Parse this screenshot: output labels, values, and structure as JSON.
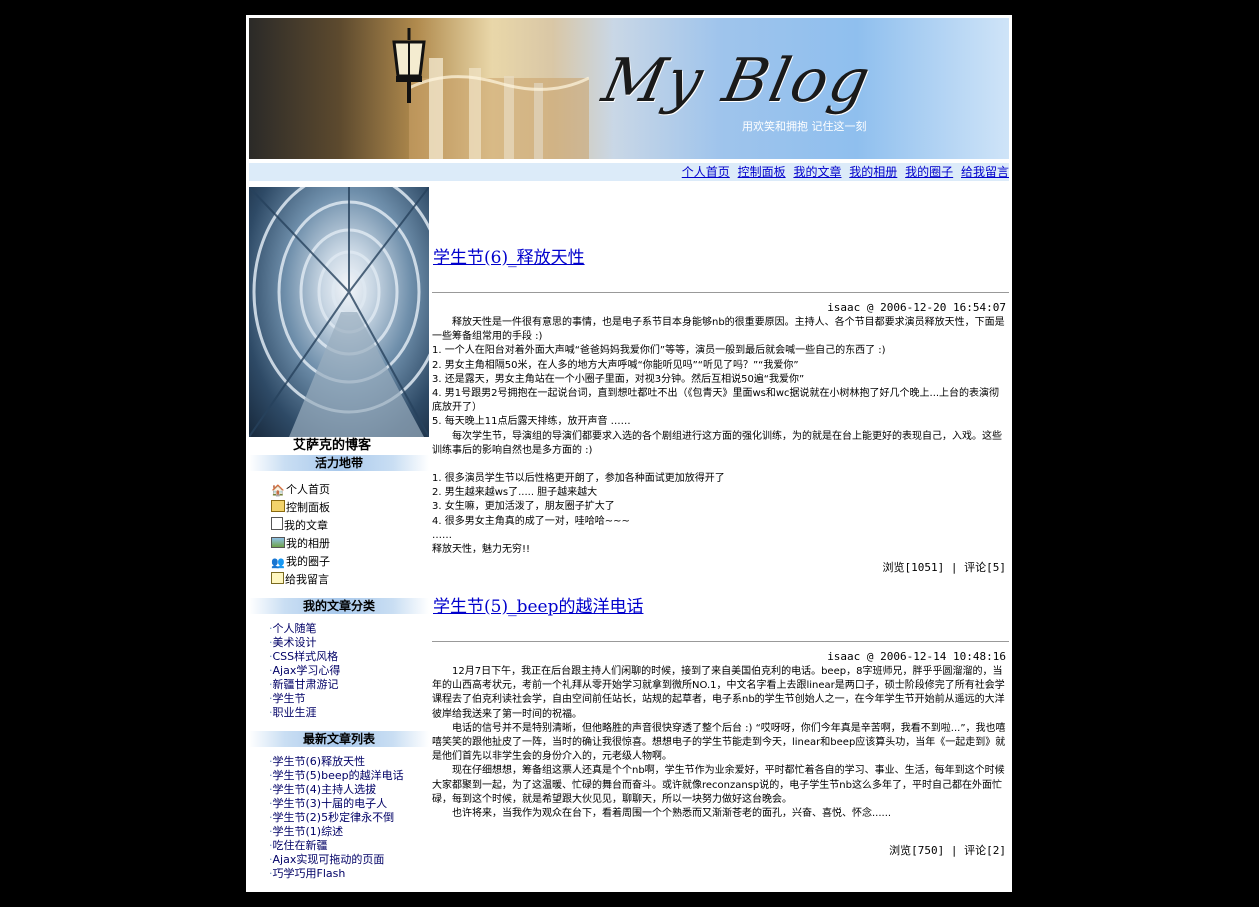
{
  "banner": {
    "logo": "My Blog",
    "motto": "用欢笑和拥抱 记住这一刻"
  },
  "nav": [
    "个人首页",
    "控制面板",
    "我的文章",
    "我的相册",
    "我的圈子",
    "给我留言"
  ],
  "sidebar": {
    "owner": "艾萨克的博客",
    "section_vitality": "活力地带",
    "menu": [
      {
        "label": "个人首页",
        "icon": "home-icon"
      },
      {
        "label": "控制面板",
        "icon": "panel-icon"
      },
      {
        "label": "我的文章",
        "icon": "article-icon"
      },
      {
        "label": "我的相册",
        "icon": "photo-icon"
      },
      {
        "label": "我的圈子",
        "icon": "group-icon"
      },
      {
        "label": "给我留言",
        "icon": "message-icon"
      }
    ],
    "section_categories": "我的文章分类",
    "categories": [
      "个人随笔",
      "美术设计",
      "CSS样式风格",
      "Ajax学习心得",
      "新疆甘肃游记",
      "学生节",
      "职业生涯"
    ],
    "section_latest": "最新文章列表",
    "latest": [
      "学生节(6)释放天性",
      "学生节(5)beep的越洋电话",
      "学生节(4)主持人选拔",
      "学生节(3)十届的电子人",
      "学生节(2)5秒定律永不倒",
      "学生节(1)综述",
      "吃住在新疆",
      "Ajax实现可拖动的页面",
      "巧学巧用Flash"
    ]
  },
  "posts": [
    {
      "title": "学生节(6)_释放天性",
      "meta": "isaac @ 2006-12-20 16:54:07",
      "paragraphs": [
        "　　释放天性是一件很有意思的事情，也是电子系节目本身能够nb的很重要原因。主持人、各个节目都要求演员释放天性，下面是一些筹备组常用的手段 :)",
        "1. 一个人在阳台对着外面大声喊“爸爸妈妈我爱你们”等等，演员一般到最后就会喊一些自己的东西了 :)",
        "2. 男女主角相隔50米，在人多的地方大声呼喊“你能听见吗”“听见了吗？”“我爱你”",
        "3. 还是露天，男女主角站在一个小圈子里面，对视3分钟。然后互相说50遍“我爱你”",
        "4. 男1号跟男2号拥抱在一起说台词，直到想吐都吐不出（《包青天》里面ws和wc据说就在小树林抱了好几个晚上...上台的表演彻底放开了）",
        "5. 每天晚上11点后露天排练，放开声音 ……",
        "　　每次学生节，导演组的导演们都要求入选的各个剧组进行这方面的强化训练，为的就是在台上能更好的表现自己，入戏。这些训练事后的影响自然也是多方面的 :)",
        "",
        "1. 很多演员学生节以后性格更开朗了，参加各种面试更加放得开了",
        "2. 男生越来越ws了.....  胆子越来越大",
        "3. 女生嘛，更加活泼了，朋友圈子扩大了",
        "4. 很多男女主角真的成了一对，哇哈哈~~~",
        "……",
        "释放天性，魅力无穷!!"
      ],
      "stats": "浏览[1051] | 评论[5]"
    },
    {
      "title": "学生节(5)_beep的越洋电话",
      "meta": "isaac @ 2006-12-14 10:48:16",
      "paragraphs": [
        "　　12月7日下午，我正在后台跟主持人们闲聊的时候，接到了来自美国伯克利的电话。beep，8字班师兄，胖乎乎圆溜溜的，当年的山西高考状元，考前一个礼拜从零开始学习就拿到微所NO.1，中文名字看上去跟linear是两口子，硕士阶段修完了所有社会学课程去了伯克利读社会学，自由空间前任站长，站规的起草者，电子系nb的学生节创始人之一，在今年学生节开始前从遥远的大洋彼岸给我送来了第一时间的祝福。",
        "　　电话的信号并不是特别清晰，但他略胜的声音很快穿透了整个后台 :) “哎呀呀，你们今年真是辛苦啊，我看不到啦...”，我也嘻嘻笑笑的跟他扯皮了一阵，当时的确让我很惊喜。想想电子的学生节能走到今天，linear和beep应该算头功，当年《一起走到》就是他们首先以非学生会的身份介入的，元老级人物啊。",
        "　　现在仔细想想，筹备组这票人还真是个个nb啊，学生节作为业余爱好，平时都忙着各自的学习、事业、生活，每年到这个时候大家都聚到一起，为了这温暖、忙碌的舞台而奋斗。或许就像reconzansp说的，电子学生节nb这么多年了，平时自己都在外面忙碌，每到这个时候，就是希望跟大伙见见，聊聊天，所以一块努力做好这台晚会。",
        "　　也许将来，当我作为观众在台下，看着周围一个个熟悉而又渐渐苍老的面孔，兴奋、喜悦、怀念......"
      ],
      "stats": "浏览[750] | 评论[2]"
    }
  ]
}
